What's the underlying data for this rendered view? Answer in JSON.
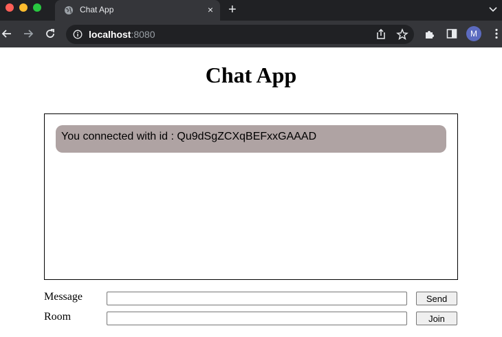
{
  "browser": {
    "tab_title": "Chat App",
    "tab_close": "×",
    "new_tab": "+",
    "url_host": "localhost",
    "url_port": ":8080",
    "profile_initial": "M"
  },
  "page": {
    "title": "Chat App",
    "messages": [
      {
        "text": "You connected with id : Qu9dSgZCXqBEFxxGAAAD"
      }
    ],
    "message_label": "Message",
    "message_value": "",
    "send_label": "Send",
    "room_label": "Room",
    "room_value": "",
    "join_label": "Join"
  },
  "colors": {
    "message_bubble": "#afa3a3",
    "tab_bar": "#202124",
    "toolbar": "#35363a"
  }
}
